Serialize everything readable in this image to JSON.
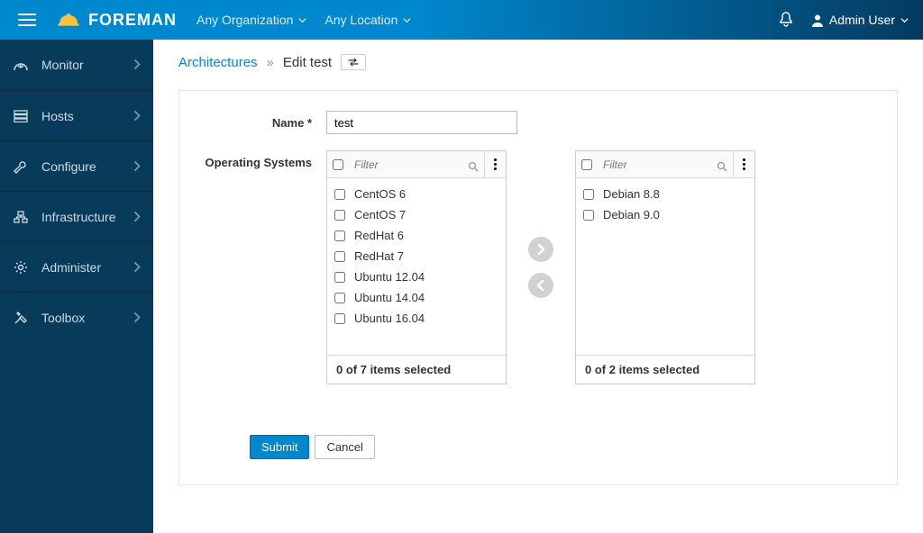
{
  "brand": {
    "name": "FOREMAN"
  },
  "context": {
    "org_label": "Any Organization",
    "loc_label": "Any Location"
  },
  "user": {
    "display": "Admin User"
  },
  "sidebar": {
    "items": [
      {
        "label": "Monitor",
        "icon": "dashboard"
      },
      {
        "label": "Hosts",
        "icon": "servers"
      },
      {
        "label": "Configure",
        "icon": "wrench"
      },
      {
        "label": "Infrastructure",
        "icon": "network"
      },
      {
        "label": "Administer",
        "icon": "gear"
      },
      {
        "label": "Toolbox",
        "icon": "tools"
      }
    ]
  },
  "breadcrumb": {
    "parent": "Architectures",
    "current": "Edit test"
  },
  "form": {
    "name_label": "Name *",
    "name_value": "test",
    "os_label": "Operating Systems",
    "filter_placeholder": "Filter",
    "available": {
      "items": [
        "CentOS 6",
        "CentOS 7",
        "RedHat 6",
        "RedHat 7",
        "Ubuntu 12.04",
        "Ubuntu 14.04",
        "Ubuntu 16.04"
      ],
      "footer": "0 of 7 items selected"
    },
    "selected": {
      "items": [
        "Debian 8.8",
        "Debian 9.0"
      ],
      "footer": "0 of 2 items selected"
    },
    "submit_label": "Submit",
    "cancel_label": "Cancel"
  }
}
